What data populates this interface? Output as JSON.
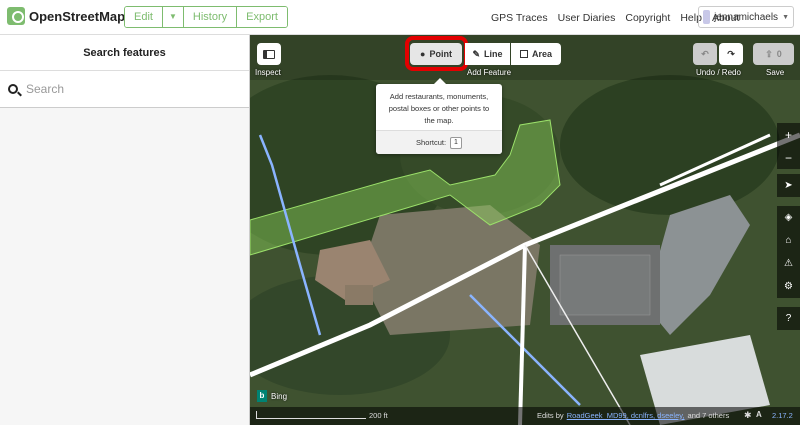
{
  "navbar": {
    "brand": "OpenStreetMap",
    "edit_label": "Edit",
    "history_label": "History",
    "export_label": "Export",
    "links": [
      "GPS Traces",
      "User Diaries",
      "Copyright",
      "Help",
      "About"
    ],
    "username": "jennamichaels"
  },
  "sidebar": {
    "title": "Search features",
    "search_placeholder": "Search"
  },
  "map": {
    "inspect_label": "Inspect",
    "point_label": "Point",
    "line_label": "Line",
    "area_label": "Area",
    "add_feature_label": "Add Feature",
    "undo_redo_label": "Undo / Redo",
    "save_label": "Save",
    "save_count": "0",
    "tooltip": {
      "description": "Add restaurants, monuments, postal boxes or other points to the map.",
      "shortcut_label": "Shortcut:",
      "shortcut_key": "1"
    },
    "imagery_label": "Bing",
    "scale_label": "200 ft",
    "edits_prefix": "Edits by",
    "editors": "RoadGeek_MD99, dcnlfrs, dseeley,",
    "edits_suffix": "and 7 others",
    "version": "2.17.2"
  },
  "colors": {
    "brand_green": "#7ebc6f",
    "highlight_red": "#e30000"
  }
}
